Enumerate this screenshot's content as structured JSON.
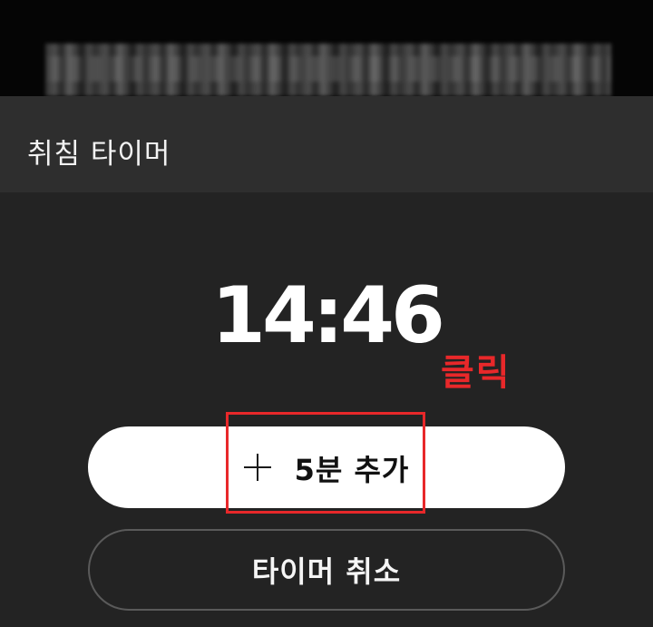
{
  "header": {
    "title": "취침 타이머"
  },
  "timer": {
    "remaining": "14:46"
  },
  "annotation": {
    "label": "클릭",
    "color": "#e8282a"
  },
  "buttons": {
    "add_label": "5분 추가",
    "add_icon": "plus-icon",
    "cancel_label": "타이머 취소"
  },
  "colors": {
    "background": "#232323",
    "header_background": "#2e2e2e",
    "primary_button": "#ffffff",
    "highlight": "#e8282a"
  }
}
